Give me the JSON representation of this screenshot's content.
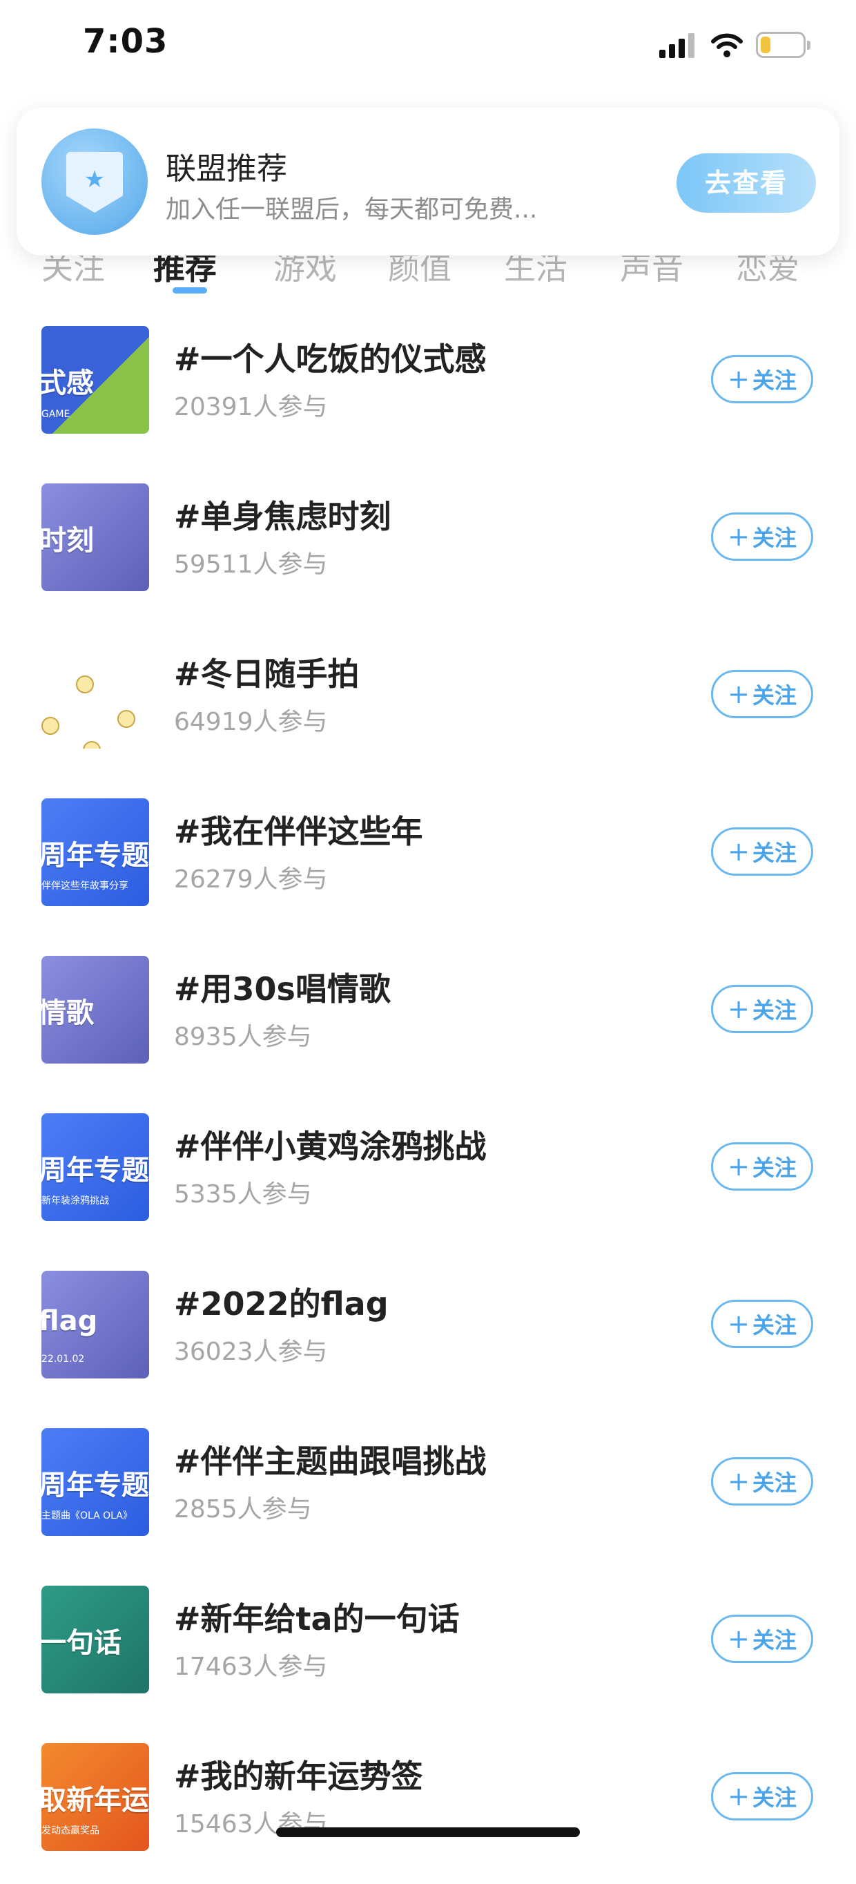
{
  "status_bar": {
    "time": "7:03"
  },
  "tabs": [
    {
      "label": "关注",
      "active": false
    },
    {
      "label": "推荐",
      "active": true
    },
    {
      "label": "游戏",
      "active": false
    },
    {
      "label": "颜值",
      "active": false
    },
    {
      "label": "生活",
      "active": false
    },
    {
      "label": "声音",
      "active": false
    },
    {
      "label": "恋爱",
      "active": false
    }
  ],
  "banner": {
    "title": "联盟推荐",
    "subtitle": "加入任一联盟后，每天都可免费...",
    "button": "去查看"
  },
  "topics": [
    {
      "title": "#一个人吃饭的仪式感",
      "count": "20391人参与",
      "follow": "关注",
      "thumb_text": "式感",
      "thumb_sub": "GAME",
      "thumb_style": "mix",
      "thumb_icon": "event-poster-icon"
    },
    {
      "title": "#单身焦虑时刻",
      "count": "59511人参与",
      "follow": "关注",
      "thumb_text": "时刻",
      "thumb_sub": "",
      "thumb_style": "purple",
      "thumb_icon": "topic-poster-icon"
    },
    {
      "title": "#冬日随手拍",
      "count": "64919人参与",
      "follow": "关注",
      "thumb_text": "",
      "thumb_sub": "",
      "thumb_style": "white",
      "thumb_icon": "chick-icon"
    },
    {
      "title": "#我在伴伴这些年",
      "count": "26279人参与",
      "follow": "关注",
      "thumb_text": "周年专题",
      "thumb_sub": "伴伴这些年故事分享",
      "thumb_style": "blue",
      "thumb_icon": "anniversary-poster-icon"
    },
    {
      "title": "#用30s唱情歌",
      "count": "8935人参与",
      "follow": "关注",
      "thumb_text": "情歌",
      "thumb_sub": "",
      "thumb_style": "purple",
      "thumb_icon": "topic-poster-icon"
    },
    {
      "title": "#伴伴小黄鸡涂鸦挑战",
      "count": "5335人参与",
      "follow": "关注",
      "thumb_text": "周年专题",
      "thumb_sub": "新年装涂鸦挑战",
      "thumb_style": "blue",
      "thumb_icon": "anniversary-poster-icon"
    },
    {
      "title": "#2022的flag",
      "count": "36023人参与",
      "follow": "关注",
      "thumb_text": "flag",
      "thumb_sub": "22.01.02",
      "thumb_style": "purple",
      "thumb_icon": "topic-poster-icon"
    },
    {
      "title": "#伴伴主题曲跟唱挑战",
      "count": "2855人参与",
      "follow": "关注",
      "thumb_text": "周年专题",
      "thumb_sub": "主题曲《OLA OLA》",
      "thumb_style": "blue",
      "thumb_icon": "anniversary-poster-icon"
    },
    {
      "title": "#新年给ta的一句话",
      "count": "17463人参与",
      "follow": "关注",
      "thumb_text": "一句话",
      "thumb_sub": "",
      "thumb_style": "green",
      "thumb_icon": "character-poster-icon"
    },
    {
      "title": "#我的新年运势签",
      "count": "15463人参与",
      "follow": "关注",
      "thumb_text": "取新年运势",
      "thumb_sub": "发动态赢奖品",
      "thumb_style": "orange",
      "thumb_icon": "fortune-poster-icon"
    }
  ]
}
